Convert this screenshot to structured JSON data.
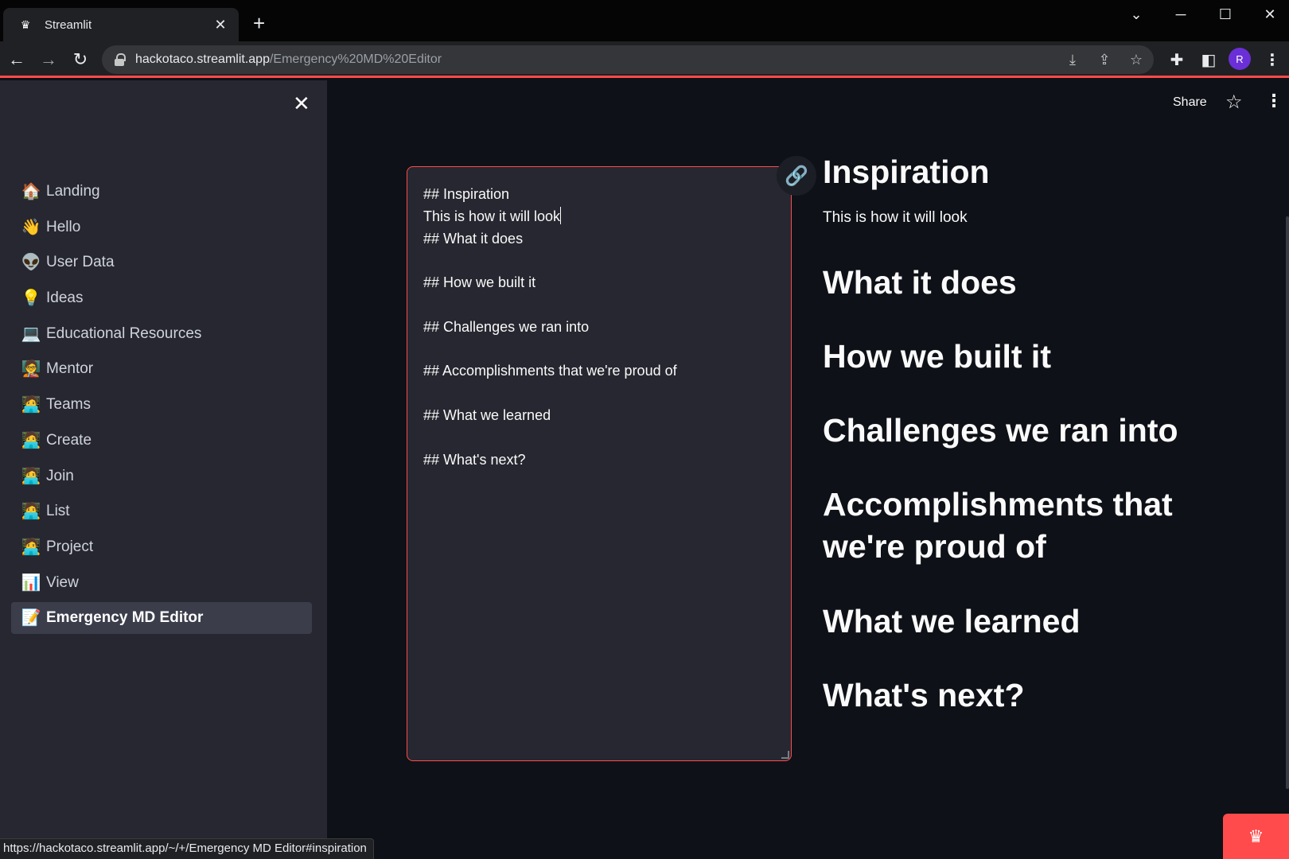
{
  "browser": {
    "tab_title": "Streamlit",
    "url_host": "hackotaco.streamlit.app",
    "url_path": "/Emergency%20MD%20Editor",
    "avatar_initial": "R",
    "status_url": "https://hackotaco.streamlit.app/~/+/Emergency MD Editor#inspiration"
  },
  "sidebar": {
    "items": [
      {
        "label": "Landing",
        "icon": "🏠",
        "icon_name": "house-icon"
      },
      {
        "label": "Hello",
        "icon": "👋",
        "icon_name": "waving-hand-icon"
      },
      {
        "label": "User Data",
        "icon": "👽",
        "icon_name": "alien-icon"
      },
      {
        "label": "Ideas",
        "icon": "💡",
        "icon_name": "lightbulb-icon"
      },
      {
        "label": "Educational Resources",
        "icon": "💻",
        "icon_name": "laptop-icon"
      },
      {
        "label": "Mentor",
        "icon": "🧑‍🏫",
        "icon_name": "teacher-icon"
      },
      {
        "label": "Teams",
        "icon": "🧑‍💻",
        "icon_name": "technologist-icon"
      },
      {
        "label": "Create",
        "icon": "🧑‍💻",
        "icon_name": "technologist-icon"
      },
      {
        "label": "Join",
        "icon": "🧑‍💻",
        "icon_name": "technologist-icon"
      },
      {
        "label": "List",
        "icon": "🧑‍💻",
        "icon_name": "technologist-icon"
      },
      {
        "label": "Project",
        "icon": "🧑‍💻",
        "icon_name": "technologist-icon"
      },
      {
        "label": "View",
        "icon": "📊",
        "icon_name": "bar-chart-icon"
      },
      {
        "label": "Emergency MD Editor",
        "icon": "📝",
        "icon_name": "memo-icon",
        "active": true
      }
    ]
  },
  "header": {
    "share_label": "Share"
  },
  "editor": {
    "lines": [
      "## Inspiration",
      "This is how it will look",
      "## What it does",
      "",
      "## How we built it",
      "",
      "## Challenges we ran into",
      "",
      "## Accomplishments that we're proud of",
      "",
      "## What we learned",
      "",
      "## What's next?"
    ]
  },
  "preview": {
    "h_inspiration": "Inspiration",
    "p_inspiration": "This is how it will look",
    "h_what": "What it does",
    "h_how": "How we built it",
    "h_challenges": "Challenges we ran into",
    "h_accomplishments": "Accomplishments that we're proud of",
    "h_learned": "What we learned",
    "h_next": "What's next?"
  },
  "colors": {
    "accent": "#ff4b4b",
    "sidebar_bg": "#262730",
    "main_bg": "#0e1117"
  }
}
